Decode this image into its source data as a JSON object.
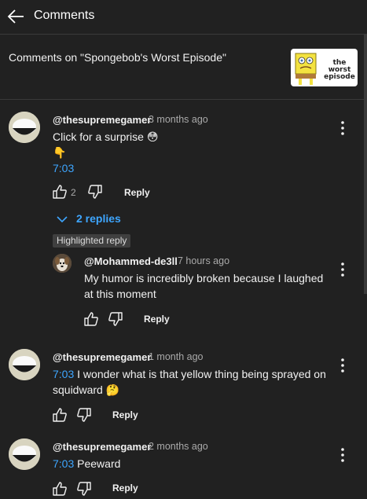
{
  "header": {
    "title": "Comments",
    "back_icon": "arrow-left-icon"
  },
  "video": {
    "title": "Comments on \"Spongebob's Worst Episode\"",
    "thumbnail_text": "the worst episode"
  },
  "comments": [
    {
      "author": "@thesupremegamer",
      "time": "3 months ago",
      "line1": "Click for a surprise",
      "emoji1": "😳",
      "emoji2": "👇",
      "timestamp": "7:03",
      "likes": "2",
      "reply_label": "Reply",
      "replies_toggle": "2 replies",
      "reply": {
        "badge": "Highlighted reply",
        "author": "@Mohammed-de3ll",
        "time": "7 hours ago",
        "line1": "My humor is incredibly broken because I laughed",
        "line2": "at this moment",
        "reply_label": "Reply"
      }
    },
    {
      "author": "@thesupremegamer",
      "time": "1 month ago",
      "timestamp": "7:03",
      "line1_rest": " I wonder what is that yellow thing being sprayed on",
      "line2": "squidward",
      "emoji": "🤔",
      "reply_label": "Reply"
    },
    {
      "author": "@thesupremegamer",
      "time": "2 months ago",
      "timestamp": "7:03",
      "text_rest": " Peeward",
      "reply_label": "Reply"
    }
  ],
  "colors": {
    "background": "#212121",
    "link": "#3ea6ff",
    "muted": "#aaaaaa"
  }
}
